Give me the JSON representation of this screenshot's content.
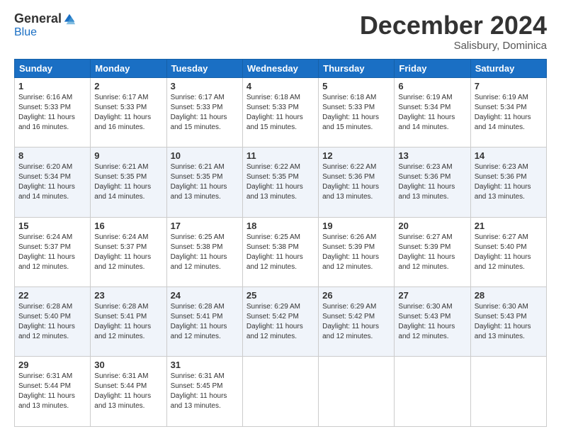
{
  "header": {
    "logo_general": "General",
    "logo_blue": "Blue",
    "month_title": "December 2024",
    "location": "Salisbury, Dominica"
  },
  "days_of_week": [
    "Sunday",
    "Monday",
    "Tuesday",
    "Wednesday",
    "Thursday",
    "Friday",
    "Saturday"
  ],
  "weeks": [
    [
      {
        "day": "1",
        "sunrise": "6:16 AM",
        "sunset": "5:33 PM",
        "daylight": "11 hours and 16 minutes."
      },
      {
        "day": "2",
        "sunrise": "6:17 AM",
        "sunset": "5:33 PM",
        "daylight": "11 hours and 16 minutes."
      },
      {
        "day": "3",
        "sunrise": "6:17 AM",
        "sunset": "5:33 PM",
        "daylight": "11 hours and 15 minutes."
      },
      {
        "day": "4",
        "sunrise": "6:18 AM",
        "sunset": "5:33 PM",
        "daylight": "11 hours and 15 minutes."
      },
      {
        "day": "5",
        "sunrise": "6:18 AM",
        "sunset": "5:33 PM",
        "daylight": "11 hours and 15 minutes."
      },
      {
        "day": "6",
        "sunrise": "6:19 AM",
        "sunset": "5:34 PM",
        "daylight": "11 hours and 14 minutes."
      },
      {
        "day": "7",
        "sunrise": "6:19 AM",
        "sunset": "5:34 PM",
        "daylight": "11 hours and 14 minutes."
      }
    ],
    [
      {
        "day": "8",
        "sunrise": "6:20 AM",
        "sunset": "5:34 PM",
        "daylight": "11 hours and 14 minutes."
      },
      {
        "day": "9",
        "sunrise": "6:21 AM",
        "sunset": "5:35 PM",
        "daylight": "11 hours and 14 minutes."
      },
      {
        "day": "10",
        "sunrise": "6:21 AM",
        "sunset": "5:35 PM",
        "daylight": "11 hours and 13 minutes."
      },
      {
        "day": "11",
        "sunrise": "6:22 AM",
        "sunset": "5:35 PM",
        "daylight": "11 hours and 13 minutes."
      },
      {
        "day": "12",
        "sunrise": "6:22 AM",
        "sunset": "5:36 PM",
        "daylight": "11 hours and 13 minutes."
      },
      {
        "day": "13",
        "sunrise": "6:23 AM",
        "sunset": "5:36 PM",
        "daylight": "11 hours and 13 minutes."
      },
      {
        "day": "14",
        "sunrise": "6:23 AM",
        "sunset": "5:36 PM",
        "daylight": "11 hours and 13 minutes."
      }
    ],
    [
      {
        "day": "15",
        "sunrise": "6:24 AM",
        "sunset": "5:37 PM",
        "daylight": "11 hours and 12 minutes."
      },
      {
        "day": "16",
        "sunrise": "6:24 AM",
        "sunset": "5:37 PM",
        "daylight": "11 hours and 12 minutes."
      },
      {
        "day": "17",
        "sunrise": "6:25 AM",
        "sunset": "5:38 PM",
        "daylight": "11 hours and 12 minutes."
      },
      {
        "day": "18",
        "sunrise": "6:25 AM",
        "sunset": "5:38 PM",
        "daylight": "11 hours and 12 minutes."
      },
      {
        "day": "19",
        "sunrise": "6:26 AM",
        "sunset": "5:39 PM",
        "daylight": "11 hours and 12 minutes."
      },
      {
        "day": "20",
        "sunrise": "6:27 AM",
        "sunset": "5:39 PM",
        "daylight": "11 hours and 12 minutes."
      },
      {
        "day": "21",
        "sunrise": "6:27 AM",
        "sunset": "5:40 PM",
        "daylight": "11 hours and 12 minutes."
      }
    ],
    [
      {
        "day": "22",
        "sunrise": "6:28 AM",
        "sunset": "5:40 PM",
        "daylight": "11 hours and 12 minutes."
      },
      {
        "day": "23",
        "sunrise": "6:28 AM",
        "sunset": "5:41 PM",
        "daylight": "11 hours and 12 minutes."
      },
      {
        "day": "24",
        "sunrise": "6:28 AM",
        "sunset": "5:41 PM",
        "daylight": "11 hours and 12 minutes."
      },
      {
        "day": "25",
        "sunrise": "6:29 AM",
        "sunset": "5:42 PM",
        "daylight": "11 hours and 12 minutes."
      },
      {
        "day": "26",
        "sunrise": "6:29 AM",
        "sunset": "5:42 PM",
        "daylight": "11 hours and 12 minutes."
      },
      {
        "day": "27",
        "sunrise": "6:30 AM",
        "sunset": "5:43 PM",
        "daylight": "11 hours and 12 minutes."
      },
      {
        "day": "28",
        "sunrise": "6:30 AM",
        "sunset": "5:43 PM",
        "daylight": "11 hours and 13 minutes."
      }
    ],
    [
      {
        "day": "29",
        "sunrise": "6:31 AM",
        "sunset": "5:44 PM",
        "daylight": "11 hours and 13 minutes."
      },
      {
        "day": "30",
        "sunrise": "6:31 AM",
        "sunset": "5:44 PM",
        "daylight": "11 hours and 13 minutes."
      },
      {
        "day": "31",
        "sunrise": "6:31 AM",
        "sunset": "5:45 PM",
        "daylight": "11 hours and 13 minutes."
      },
      null,
      null,
      null,
      null
    ]
  ],
  "labels": {
    "sunrise": "Sunrise: ",
    "sunset": "Sunset: ",
    "daylight": "Daylight: "
  }
}
